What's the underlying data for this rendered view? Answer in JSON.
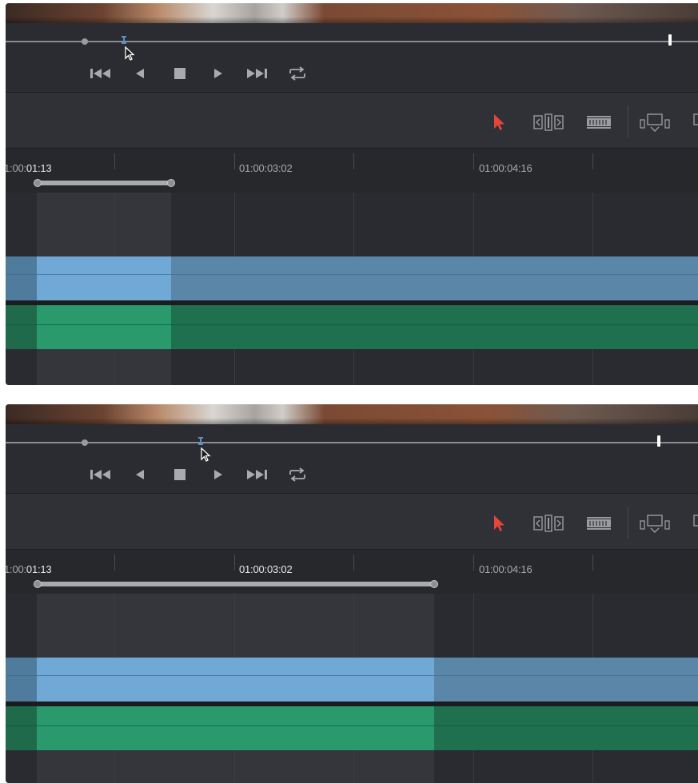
{
  "panels": [
    {
      "timecodes": {
        "first_prefix": "1:00:",
        "first_bright": "01:13",
        "second": "01:00:03:02",
        "third": "01:00:04:16"
      }
    },
    {
      "timecodes": {
        "first_prefix": "1:00:",
        "first_bright": "01:13",
        "second": "01:00:03:02",
        "third": "01:00:04:16"
      }
    }
  ],
  "transport": {
    "buttons": [
      "jump-to-start",
      "play-reverse",
      "stop",
      "play-forward",
      "jump-to-end",
      "loop"
    ]
  },
  "toolbar": {
    "tools": [
      "selection-mode",
      "trim-edit-mode",
      "blade-edit-mode",
      "insert-clip"
    ],
    "active_tool": "selection-mode"
  },
  "colors": {
    "selection_tool": "#e8443a",
    "video_track_selected": "#70a9d6",
    "video_track": "#5a86a8",
    "audio_track_selected": "#2a9a6d",
    "audio_track": "#1f704e",
    "playhead_marker": "#5b8fc6"
  }
}
